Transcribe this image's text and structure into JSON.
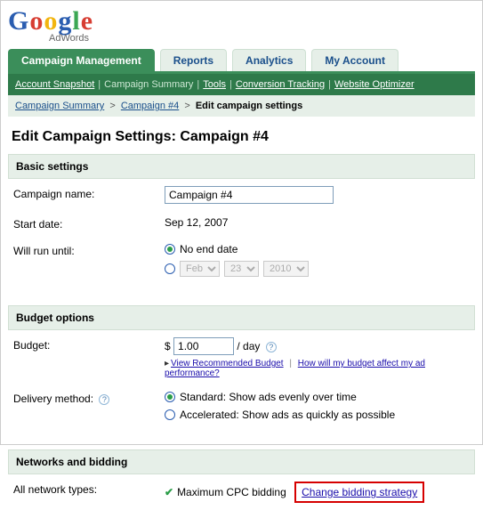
{
  "logo": {
    "product": "AdWords"
  },
  "tabs": [
    {
      "id": "campaign-mgmt",
      "label": "Campaign Management",
      "active": true
    },
    {
      "id": "reports",
      "label": "Reports",
      "active": false
    },
    {
      "id": "analytics",
      "label": "Analytics",
      "active": false
    },
    {
      "id": "my-account",
      "label": "My Account",
      "active": false
    }
  ],
  "subnav": {
    "items": [
      {
        "label": "Account Snapshot",
        "current": false
      },
      {
        "label": "Campaign Summary",
        "current": true
      },
      {
        "label": "Tools",
        "current": false
      },
      {
        "label": "Conversion Tracking",
        "current": false
      },
      {
        "label": "Website Optimizer",
        "current": false
      }
    ]
  },
  "breadcrumb": {
    "items": [
      {
        "label": "Campaign Summary",
        "link": true
      },
      {
        "label": "Campaign #4",
        "link": true
      },
      {
        "label": "Edit campaign settings",
        "link": false
      }
    ]
  },
  "page_title": "Edit Campaign Settings: Campaign #4",
  "sections": {
    "basic": {
      "header": "Basic settings",
      "campaign_name_label": "Campaign name:",
      "campaign_name_value": "Campaign #4",
      "start_date_label": "Start date:",
      "start_date_value": "Sep 12, 2007",
      "will_run_label": "Will run until:",
      "no_end_label": "No end date",
      "end_month": "Feb",
      "end_day": "23",
      "end_year": "2010"
    },
    "budget": {
      "header": "Budget options",
      "budget_label": "Budget:",
      "currency": "$",
      "budget_value": "1.00",
      "per_day": "/ day",
      "view_recommended": "View Recommended Budget",
      "how_affect": "How will my budget affect my ad performance?",
      "delivery_label": "Delivery method:",
      "standard": "Standard: Show ads evenly over time",
      "accelerated": "Accelerated: Show ads as quickly as possible"
    },
    "networks": {
      "header": "Networks and bidding",
      "all_types_label": "All network types:",
      "max_cpc": "Maximum CPC bidding",
      "change_strategy": "Change bidding strategy"
    }
  }
}
